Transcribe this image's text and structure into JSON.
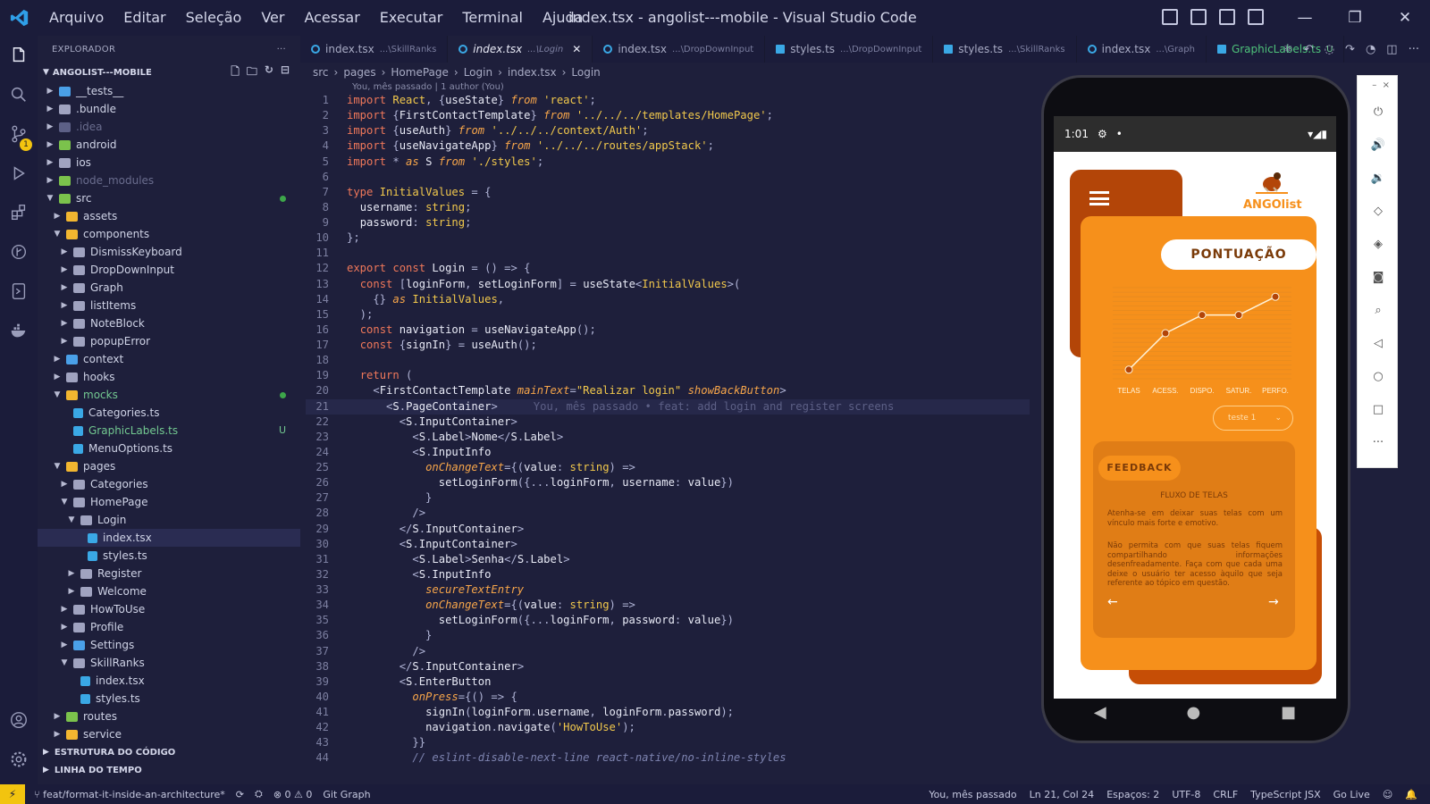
{
  "menu": [
    "Arquivo",
    "Editar",
    "Seleção",
    "Ver",
    "Acessar",
    "Executar",
    "Terminal",
    "Ajuda"
  ],
  "window_title": "index.tsx - angolist---mobile - Visual Studio Code",
  "window_controls": {
    "minimize": "—",
    "restore": "❐",
    "close": "✕"
  },
  "explorer": {
    "header": "EXPLORADOR",
    "project": "ANGOLIST---MOBILE",
    "tree": [
      {
        "label": "__tests__",
        "depth": 1,
        "type": "folder",
        "color": "#4aa0e8"
      },
      {
        "label": ".bundle",
        "depth": 1,
        "type": "folder",
        "color": "#a0a3c0"
      },
      {
        "label": ".idea",
        "depth": 1,
        "type": "folder",
        "color": "#5d6086",
        "dim": true
      },
      {
        "label": "android",
        "depth": 1,
        "type": "folder",
        "color": "#7bc24c"
      },
      {
        "label": "ios",
        "depth": 1,
        "type": "folder",
        "color": "#a0a3c0"
      },
      {
        "label": "node_modules",
        "depth": 1,
        "type": "folder",
        "color": "#7bc24c",
        "dim": true
      },
      {
        "label": "src",
        "depth": 1,
        "type": "folder",
        "color": "#7bc24c",
        "open": true,
        "dot": true
      },
      {
        "label": "assets",
        "depth": 2,
        "type": "folder",
        "color": "#f2b630"
      },
      {
        "label": "components",
        "depth": 2,
        "type": "folder",
        "color": "#f2b630",
        "open": true
      },
      {
        "label": "DismissKeyboard",
        "depth": 3,
        "type": "folder",
        "color": "#a0a3c0"
      },
      {
        "label": "DropDownInput",
        "depth": 3,
        "type": "folder",
        "color": "#a0a3c0"
      },
      {
        "label": "Graph",
        "depth": 3,
        "type": "folder",
        "color": "#a0a3c0"
      },
      {
        "label": "listItems",
        "depth": 3,
        "type": "folder",
        "color": "#a0a3c0"
      },
      {
        "label": "NoteBlock",
        "depth": 3,
        "type": "folder",
        "color": "#a0a3c0"
      },
      {
        "label": "popupError",
        "depth": 3,
        "type": "folder",
        "color": "#a0a3c0"
      },
      {
        "label": "context",
        "depth": 2,
        "type": "folder",
        "color": "#4aa0e8"
      },
      {
        "label": "hooks",
        "depth": 2,
        "type": "folder",
        "color": "#a0a3c0"
      },
      {
        "label": "mocks",
        "depth": 2,
        "type": "folder",
        "color": "#f2b630",
        "open": true,
        "dot": true,
        "green": true
      },
      {
        "label": "Categories.ts",
        "depth": 3,
        "type": "file",
        "color": "#3aa8e5"
      },
      {
        "label": "GraphicLabels.ts",
        "depth": 3,
        "type": "file",
        "color": "#3aa8e5",
        "green": true,
        "u": "U"
      },
      {
        "label": "MenuOptions.ts",
        "depth": 3,
        "type": "file",
        "color": "#3aa8e5"
      },
      {
        "label": "pages",
        "depth": 2,
        "type": "folder",
        "color": "#f2b630",
        "open": true
      },
      {
        "label": "Categories",
        "depth": 3,
        "type": "folder",
        "color": "#a0a3c0"
      },
      {
        "label": "HomePage",
        "depth": 3,
        "type": "folder",
        "color": "#a0a3c0",
        "open": true
      },
      {
        "label": "Login",
        "depth": 4,
        "type": "folder",
        "color": "#a0a3c0",
        "open": true
      },
      {
        "label": "index.tsx",
        "depth": 5,
        "type": "file",
        "color": "#3aa8e5",
        "selected": true
      },
      {
        "label": "styles.ts",
        "depth": 5,
        "type": "file",
        "color": "#3aa8e5"
      },
      {
        "label": "Register",
        "depth": 4,
        "type": "folder",
        "color": "#a0a3c0"
      },
      {
        "label": "Welcome",
        "depth": 4,
        "type": "folder",
        "color": "#a0a3c0"
      },
      {
        "label": "HowToUse",
        "depth": 3,
        "type": "folder",
        "color": "#a0a3c0"
      },
      {
        "label": "Profile",
        "depth": 3,
        "type": "folder",
        "color": "#a0a3c0"
      },
      {
        "label": "Settings",
        "depth": 3,
        "type": "folder",
        "color": "#4aa0e8"
      },
      {
        "label": "SkillRanks",
        "depth": 3,
        "type": "folder",
        "color": "#a0a3c0",
        "open": true
      },
      {
        "label": "index.tsx",
        "depth": 4,
        "type": "file",
        "color": "#3aa8e5"
      },
      {
        "label": "styles.ts",
        "depth": 4,
        "type": "file",
        "color": "#3aa8e5"
      },
      {
        "label": "routes",
        "depth": 2,
        "type": "folder",
        "color": "#7bc24c"
      },
      {
        "label": "service",
        "depth": 2,
        "type": "folder",
        "color": "#f2b630"
      }
    ],
    "sections": [
      "ESTRUTURA DO CÓDIGO",
      "LINHA DO TEMPO"
    ]
  },
  "tabs": [
    {
      "name": "index.tsx",
      "path": "...\\SkillRanks"
    },
    {
      "name": "index.tsx",
      "path": "...\\Login",
      "active": true,
      "close": "✕"
    },
    {
      "name": "index.tsx",
      "path": "...\\DropDownInput"
    },
    {
      "name": "styles.ts",
      "path": "...\\DropDownInput"
    },
    {
      "name": "styles.ts",
      "path": "...\\SkillRanks"
    },
    {
      "name": "index.tsx",
      "path": "...\\Graph"
    },
    {
      "name": "GraphicLabels.ts",
      "path": "U",
      "green": true
    }
  ],
  "breadcrumb": [
    "src",
    "pages",
    "HomePage",
    "Login",
    "index.tsx",
    "Login"
  ],
  "blame": "You, mês passado | 1 author (You)",
  "ghost_blame": "You, mês passado • feat: add login and register screens",
  "code": [
    "import React, {useState} from 'react';",
    "import {FirstContactTemplate} from '../../../templates/HomePage';",
    "import {useAuth} from '../../../context/Auth';",
    "import {useNavigateApp} from '../../../routes/appStack';",
    "import * as S from './styles';",
    "",
    "type InitialValues = {",
    "  username: string;",
    "  password: string;",
    "};",
    "",
    "export const Login = () => {",
    "  const [loginForm, setLoginForm] = useState<InitialValues>(",
    "    {} as InitialValues,",
    "  );",
    "  const navigation = useNavigateApp();",
    "  const {signIn} = useAuth();",
    "",
    "  return (",
    "    <FirstContactTemplate mainText=\"Realizar login\" showBackButton>",
    "      <S.PageContainer>",
    "        <S.InputContainer>",
    "          <S.Label>Nome</S.Label>",
    "          <S.InputInfo",
    "            onChangeText={(value: string) =>",
    "              setLoginForm({...loginForm, username: value})",
    "            }",
    "          />",
    "        </S.InputContainer>",
    "        <S.InputContainer>",
    "          <S.Label>Senha</S.Label>",
    "          <S.InputInfo",
    "            secureTextEntry",
    "            onChangeText={(value: string) =>",
    "              setLoginForm({...loginForm, password: value})",
    "            }",
    "          />",
    "        </S.InputContainer>",
    "        <S.EnterButton",
    "          onPress={() => {",
    "            signIn(loginForm.username, loginForm.password);",
    "            navigation.navigate('HowToUse');",
    "          }}",
    "          // eslint-disable-next-line react-native/no-inline-styles"
  ],
  "emulator": {
    "time": "1:01",
    "logo_text": "ANGOlist",
    "score_title": "PONTUAÇÃO",
    "select_value": "teste 1",
    "feedback_title": "FEEDBACK",
    "feedback_subtitle": "FLUXO DE TELAS",
    "feedback_p1": "Atenha-se em deixar suas telas com um vínculo mais forte e emotivo.",
    "feedback_p2": "Não permita com que suas telas fiquem compartilhando informações desenfreadamente. Faça com que cada uma deixe o usuário ter acesso àquilo que seja referente ao tópico em questão.",
    "nav": [
      "◀",
      "●",
      "■"
    ],
    "panel_icons": [
      "power-icon",
      "volume-up-icon",
      "volume-down-icon",
      "rotate-left-icon",
      "rotate-right-icon",
      "camera-icon",
      "zoom-icon",
      "back-icon",
      "home-icon",
      "overview-icon",
      "more-icon"
    ]
  },
  "chart_data": {
    "type": "line",
    "categories": [
      "TELAS",
      "ACESS.",
      "DISPO.",
      "SATUR.",
      "PERFO."
    ],
    "values": [
      1.0,
      5.0,
      7.0,
      7.0,
      9.0
    ],
    "ylim": [
      0,
      10
    ],
    "color": "#b34508"
  },
  "statusbar": {
    "branch": "feat/format-it-inside-an-architecture*",
    "problems": "⊗ 0 ⚠ 0",
    "git_graph": "Git Graph",
    "blame": "You, mês passado",
    "position": "Ln 21, Col 24",
    "spaces": "Espaços: 2",
    "encoding": "UTF-8",
    "eol": "CRLF",
    "language": "TypeScript JSX",
    "golive": "Go Live"
  }
}
